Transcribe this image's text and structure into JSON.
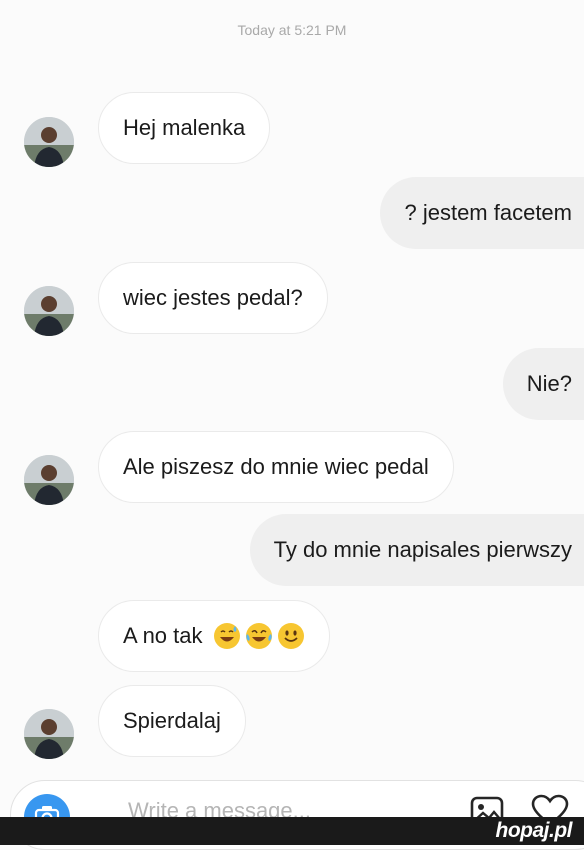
{
  "chat": {
    "timestamp": "Today at 5:21 PM",
    "messages": [
      {
        "direction": "in",
        "text": "Hej malenka"
      },
      {
        "direction": "out",
        "text": "? jestem facetem"
      },
      {
        "direction": "in",
        "text": "wiec jestes pedal?"
      },
      {
        "direction": "out",
        "text": "Nie?"
      },
      {
        "direction": "in",
        "text": "Ale piszesz do mnie wiec pedal"
      },
      {
        "direction": "out",
        "text": "Ty do mnie napisales pierwszy"
      },
      {
        "direction": "in",
        "text": "A no tak",
        "emojis": [
          "grinning-sweat-emoji",
          "tears-of-joy-emoji",
          "smiling-emoji"
        ]
      },
      {
        "direction": "in",
        "text": "Spierdalaj"
      }
    ]
  },
  "composer": {
    "placeholder": "Write a message...",
    "icons": [
      "camera-icon",
      "gallery-icon",
      "heart-icon"
    ]
  },
  "footer": {
    "brand": "hopaj.pl"
  },
  "colors": {
    "accent": "#3897f0",
    "incoming_bubble": "#ffffff",
    "outgoing_bubble": "#efefef",
    "footer_bg": "#1a1a1a"
  }
}
